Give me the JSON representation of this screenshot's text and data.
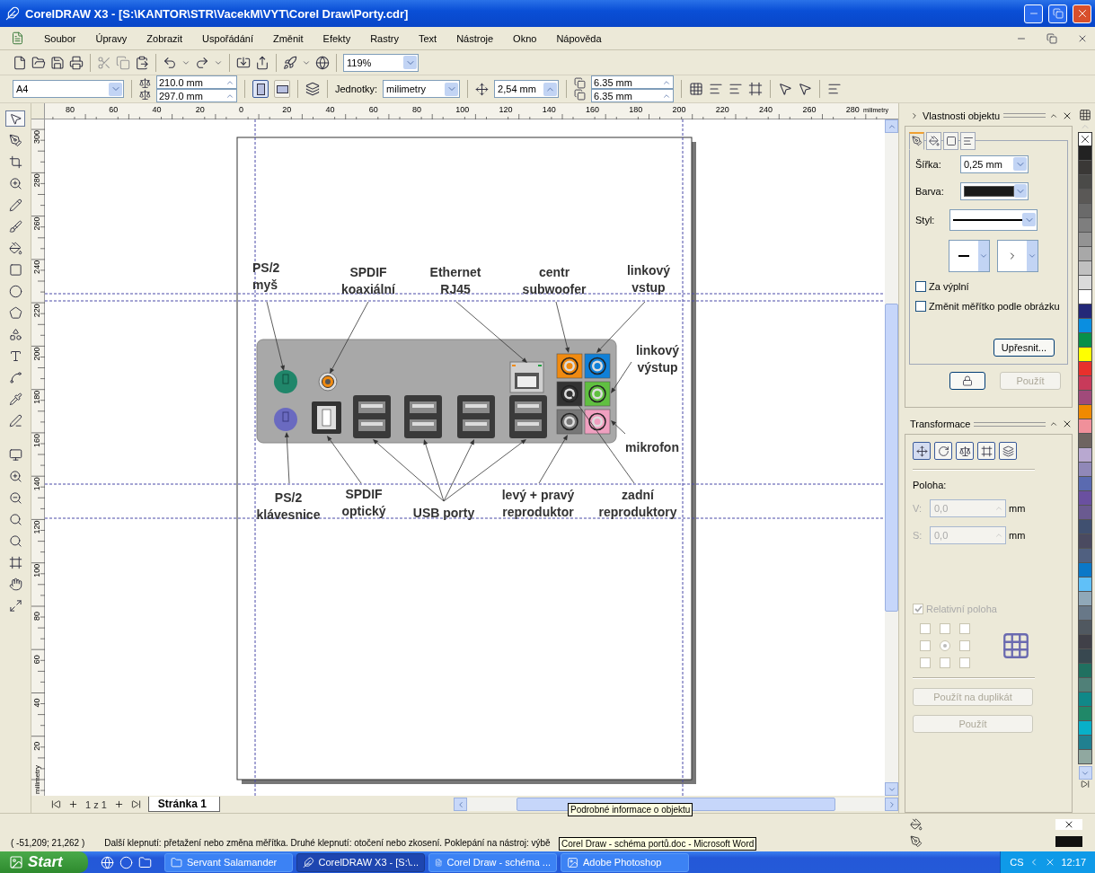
{
  "window": {
    "title": "CorelDRAW X3 - [S:\\KANTOR\\STR\\VacekM\\VYT\\Corel Draw\\Porty.cdr]"
  },
  "menu": [
    "Soubor",
    "Úpravy",
    "Zobrazit",
    "Uspořádání",
    "Změnit",
    "Efekty",
    "Rastry",
    "Text",
    "Nástroje",
    "Okno",
    "Nápověda"
  ],
  "standard_toolbar": {
    "zoom": "119%"
  },
  "property_bar": {
    "paper": "A4",
    "width": "210.0 mm",
    "height": "297.0 mm",
    "orientations": [
      {
        "selected": true
      },
      {
        "selected": false
      }
    ],
    "units_label": "Jednotky:",
    "units": "milimetry",
    "nudge": "2,54 mm",
    "duplicate_x": "6.35 mm",
    "duplicate_y": "6.35 mm"
  },
  "toolbox": {
    "tools": [
      {
        "selected": true
      },
      {
        "selected": false
      },
      {
        "selected": false
      },
      {
        "selected": false
      },
      {
        "selected": false
      },
      {
        "selected": false
      },
      {
        "selected": false
      },
      {
        "selected": false
      },
      {
        "selected": false
      },
      {
        "selected": false
      },
      {
        "selected": false
      },
      {
        "selected": false
      },
      {
        "selected": false
      },
      {
        "selected": false
      },
      {
        "selected": false
      }
    ]
  },
  "rulers": {
    "horizontal": [
      "80",
      "60",
      "40",
      "20",
      "0",
      "20",
      "40",
      "60",
      "80",
      "100",
      "120",
      "140",
      "160",
      "180",
      "200",
      "220",
      "240",
      "260",
      "280"
    ],
    "horizontal_unit": "milimetry",
    "vertical": [
      "300",
      "280",
      "260",
      "240",
      "220",
      "200",
      "180",
      "160",
      "140",
      "120",
      "100",
      "80",
      "60",
      "40",
      "20"
    ],
    "vertical_unit": "milimetry"
  },
  "diagram": {
    "callouts": [
      {
        "lines": [
          "PS/2",
          "myš"
        ]
      },
      {
        "lines": [
          "SPDIF",
          "koaxiální"
        ]
      },
      {
        "lines": [
          "Ethernet",
          "RJ45"
        ]
      },
      {
        "lines": [
          "centr",
          "subwoofer"
        ]
      },
      {
        "lines": [
          "linkový",
          "vstup"
        ]
      },
      {
        "lines": [
          "linkový",
          "výstup"
        ]
      },
      {
        "lines": [
          "mikrofon"
        ]
      },
      {
        "lines": [
          "PS/2",
          "klávesnice"
        ]
      },
      {
        "lines": [
          "SPDIF",
          "optický"
        ]
      },
      {
        "lines": [
          "USB porty"
        ]
      },
      {
        "lines": [
          "levý + pravý",
          "reproduktor"
        ]
      },
      {
        "lines": [
          "zadní",
          "reproduktory"
        ]
      }
    ]
  },
  "page_tabs": {
    "counter": "1 z 1",
    "page": "Stránka 1"
  },
  "tooltip": "Podrobné informace o objektu",
  "object_properties": {
    "title": "Vlastnosti objektu",
    "tabs": [
      {
        "selected": true
      },
      {
        "selected": false
      },
      {
        "selected": false
      },
      {
        "selected": false
      }
    ],
    "width_label": "Šířka:",
    "width": "0,25 mm",
    "color_label": "Barva:",
    "color": "#1a1a1a",
    "style_label": "Styl:",
    "checkboxes": [
      {
        "label": "Za výplní",
        "checked": false
      },
      {
        "label": "Změnit měřítko podle obrázku",
        "checked": false
      }
    ],
    "advanced": "Upřesnit...",
    "apply": {
      "label": "Použít",
      "disabled": true
    }
  },
  "transform": {
    "title": "Transformace",
    "modes": [
      {
        "selected": true
      },
      {
        "selected": false
      },
      {
        "selected": false
      },
      {
        "selected": false
      },
      {
        "selected": false
      }
    ],
    "section": "Poloha:",
    "disabled": true,
    "fields": [
      {
        "label": "V:",
        "value": "0,0",
        "unit": "mm"
      },
      {
        "label": "S:",
        "value": "0,0",
        "unit": "mm"
      }
    ],
    "relative": {
      "label": "Relativní poloha",
      "checked": true
    },
    "anchors": [
      {
        "selected": false
      },
      {
        "selected": false
      },
      {
        "selected": false
      },
      {
        "selected": false
      },
      {
        "selected": true
      },
      {
        "selected": false
      },
      {
        "selected": false
      },
      {
        "selected": false
      },
      {
        "selected": false
      }
    ],
    "buttons": [
      "Použít na duplikát",
      "Použít"
    ]
  },
  "palette": [
    {
      "color": "#222222"
    },
    {
      "color": "#3a3836"
    },
    {
      "color": "#4a4a48"
    },
    {
      "color": "#5a5856"
    },
    {
      "color": "#6a6a6a"
    },
    {
      "color": "#7e7e7e"
    },
    {
      "color": "#939393"
    },
    {
      "color": "#a8a8a8"
    },
    {
      "color": "#c0c0c0"
    },
    {
      "color": "#dadada"
    },
    {
      "color": "#ffffff"
    },
    {
      "color": "#232878"
    },
    {
      "color": "#0a8ee0"
    },
    {
      "color": "#089048"
    },
    {
      "color": "#ffff00"
    },
    {
      "color": "#e8302c"
    },
    {
      "color": "#c83a5a"
    },
    {
      "color": "#a04a7a"
    },
    {
      "color": "#f08a00"
    },
    {
      "color": "#f0909a"
    },
    {
      "color": "#6e6460"
    },
    {
      "color": "#b8a8d0"
    },
    {
      "color": "#9088b8"
    },
    {
      "color": "#5a6ab0"
    },
    {
      "color": "#6a50a0"
    },
    {
      "color": "#6a5a90"
    },
    {
      "color": "#405070"
    },
    {
      "color": "#4a4a60"
    },
    {
      "color": "#506080"
    },
    {
      "color": "#0a78c8"
    },
    {
      "color": "#60c0f8"
    },
    {
      "color": "#90a8b8"
    },
    {
      "color": "#687888"
    },
    {
      "color": "#505860"
    },
    {
      "color": "#404048"
    },
    {
      "color": "#384850"
    },
    {
      "color": "#207060"
    },
    {
      "color": "#508078"
    },
    {
      "color": "#108888"
    },
    {
      "color": "#208868"
    },
    {
      "color": "#08b0c8"
    },
    {
      "color": "#208090"
    },
    {
      "color": "#90a8a0"
    }
  ],
  "status": {
    "coordinates": "( -51,209; 21,262 )",
    "message": "Další klepnutí: přetažení nebo změna měřítka. Druhé klepnutí: otočení  nebo zkosení. Poklepání na nástroj: výbě",
    "tooltip": "Corel Draw - schéma portů.doc - Microsoft Word"
  },
  "taskbar": {
    "start": "Start",
    "tasks": [
      {
        "label": "Servant Salamander",
        "selected": false
      },
      {
        "label": "CorelDRAW X3 - [S:\\...",
        "selected": true
      },
      {
        "label": "Corel Draw - schéma ...",
        "selected": false
      },
      {
        "label": "Adobe Photoshop",
        "selected": false
      }
    ],
    "language": "CS",
    "time": "12:17"
  }
}
